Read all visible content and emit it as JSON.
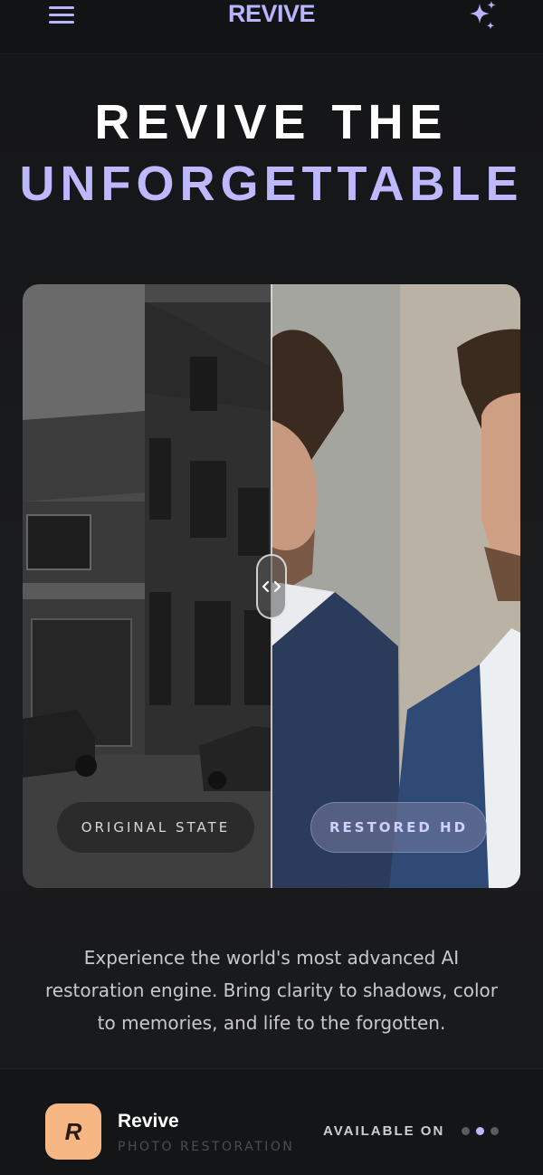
{
  "header": {
    "brand": "REVIVE",
    "menu_icon": "hamburger-menu-icon",
    "sparkle_icon": "sparkles-icon",
    "accent_color": "#b8b5ff"
  },
  "hero": {
    "line1": "REVIVE THE",
    "line2": "UNFORGETTABLE"
  },
  "compare": {
    "original_label": "ORIGINAL STATE",
    "restored_label": "RESTORED HD",
    "handle_icon": "compare-arrows-icon"
  },
  "description": "Experience the world's most advanced AI restoration engine. Bring clarity to shadows, color to memories, and life to the forgotten.",
  "footer": {
    "app_logo_letter": "R",
    "app_name": "Revive",
    "app_subtitle": "PHOTO RESTORATION",
    "available_label": "AVAILABLE ON",
    "logo_color": "#f6b784"
  }
}
